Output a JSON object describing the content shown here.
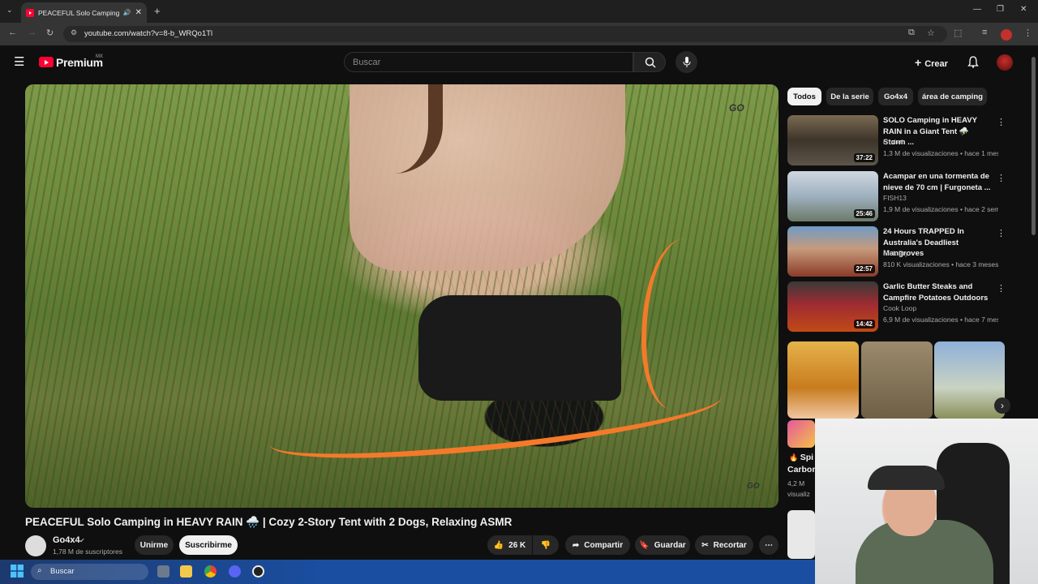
{
  "browser": {
    "tab_title": "PEACEFUL Solo Camping in",
    "url": "youtube.com/watch?v=8-b_WRQo1Tl"
  },
  "header": {
    "logo_text": "Premium",
    "logo_region": "MX",
    "search_placeholder": "Buscar",
    "create_label": "Crear"
  },
  "video": {
    "title": "PEACEFUL Solo Camping in HEAVY RAIN 🌧️ | Cozy 2-Story Tent with 2 Dogs, Relaxing ASMR",
    "watermark": "GO",
    "channel_name": "Go4x4",
    "subscribers": "1,78 M de suscriptores",
    "join_label": "Unirme",
    "subscribe_label": "Suscribirme",
    "likes": "26 K",
    "share_label": "Compartir",
    "save_label": "Guardar",
    "clip_label": "Recortar"
  },
  "chips": [
    "Todos",
    "De la serie",
    "Go4x4",
    "área de camping"
  ],
  "recommendations": [
    {
      "title": "SOLO Camping in HEAVY RAIN in a Giant Tent ⛈️ Storm ...",
      "channel": "Go4x4",
      "meta": "1,3 M de visualizaciones • hace 1 mes",
      "duration": "37:22"
    },
    {
      "title": "Acampar en una tormenta de nieve de 70 cm | Furgoneta ...",
      "channel": "FISH13",
      "meta": "1,9 M de visualizaciones • hace 2 seman...",
      "duration": "25:46"
    },
    {
      "title": "24 Hours TRAPPED In Australia's Deadliest Mangroves",
      "channel": "Nick Fry",
      "meta": "810 K visualizaciones • hace 3 meses",
      "duration": "22:57"
    },
    {
      "title": "Garlic Butter Steaks and Campfire Potatoes Outdoors",
      "channel": "Cook Loop",
      "meta": "6,9 M de visualizaciones • hace 7 meses",
      "duration": "14:42"
    }
  ],
  "partial_rec": {
    "title": "Spi",
    "title2": "Carbon",
    "meta": "4,2 M",
    "meta2": "visualiz"
  },
  "taskbar": {
    "search_label": "Buscar"
  },
  "colors": {
    "brand_red": "#ff0033",
    "background": "#0f0f0f",
    "taskbar": "#1a4ea0"
  }
}
